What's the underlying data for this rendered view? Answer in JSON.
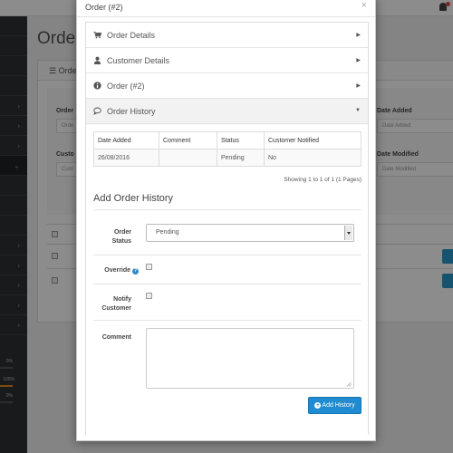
{
  "background_page": {
    "title": "Orde",
    "panel_heading": "Orde",
    "filters": {
      "order_id_label": "Order",
      "order_id_placeholder": "Orde",
      "customer_label": "Custo",
      "customer_placeholder": "Cust",
      "date_added_label": "Date Added",
      "date_added_placeholder": "Date Added",
      "date_modified_label": "Date Modified",
      "date_modified_placeholder": "Date Modified"
    },
    "progress_bars": [
      {
        "pct": "0%",
        "fill": 0,
        "color": "#f0a030"
      },
      {
        "pct": "100%",
        "fill": 1,
        "color": "#e58a1e"
      },
      {
        "pct": "0%",
        "fill": 0,
        "color": "#555555"
      }
    ]
  },
  "modal": {
    "title": "Order (#2)",
    "close_glyph": "×",
    "accordion": [
      {
        "label": "Order Details",
        "icon": "cart-icon",
        "open": false
      },
      {
        "label": "Customer Details",
        "icon": "user-icon",
        "open": false
      },
      {
        "label": "Order (#2)",
        "icon": "info-icon",
        "open": false
      },
      {
        "label": "Order History",
        "icon": "comment-icon",
        "open": true
      }
    ],
    "history": {
      "columns": [
        "Date Added",
        "Comment",
        "Status",
        "Customer Notified"
      ],
      "rows": [
        {
          "date_added": "26/08/2016",
          "comment": "",
          "status": "Pending",
          "customer_notified": "No"
        }
      ],
      "pagination": "Showing 1 to 1 of 1 (1 Pages)"
    },
    "add_history": {
      "title": "Add Order History",
      "order_status_label": "Order Status",
      "order_status_value": "Pending",
      "override_label": "Override",
      "notify_label": "Notify Customer",
      "comment_label": "Comment",
      "button_label": "Add History"
    }
  },
  "colors": {
    "primary_button": "#1f8bd0",
    "help_icon": "#2f8ac9",
    "sidebar": "#2e3133"
  }
}
